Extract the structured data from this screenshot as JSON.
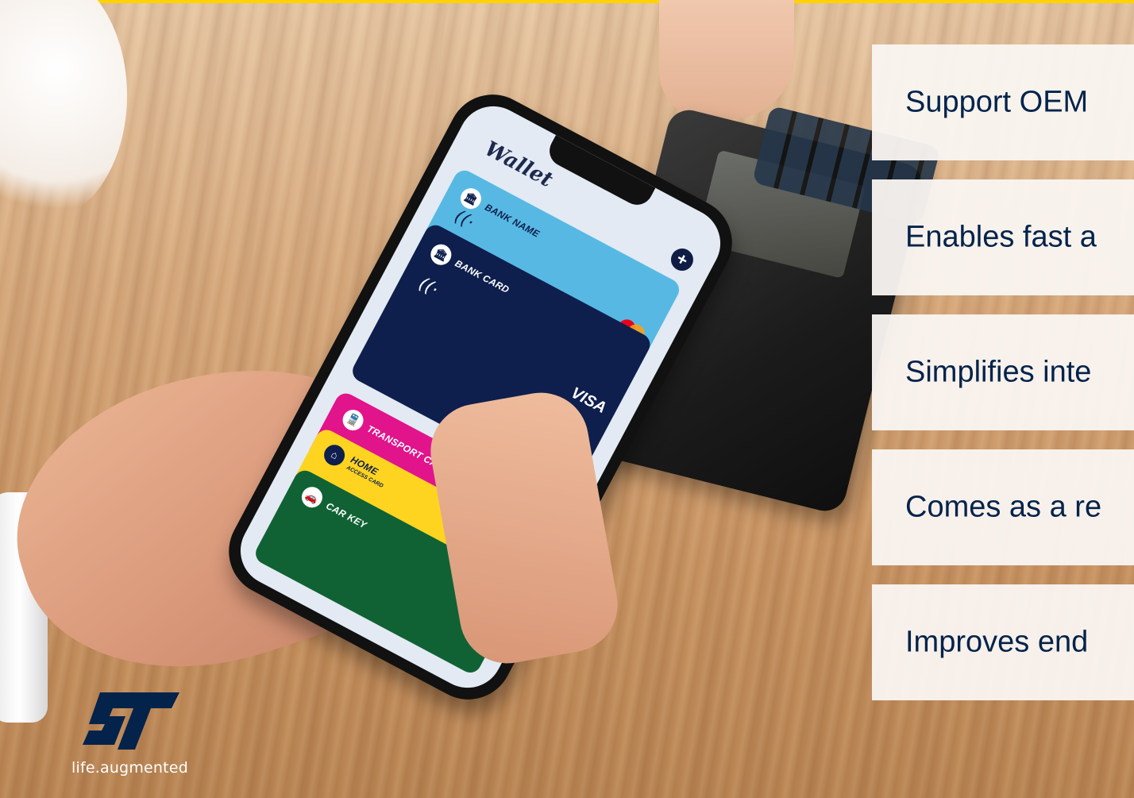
{
  "wallet": {
    "title": "Wallet",
    "add_button": "+",
    "cards": {
      "bank_name": "BANK NAME",
      "bank_card": "BANK CARD",
      "visa": "VISA",
      "transport": "TRANSPORT CARD",
      "home": "HOME",
      "home_sub": "ACCESS CARD",
      "car": "CAR KEY"
    }
  },
  "features": [
    "Support OEM",
    "Enables fast a",
    "Simplifies inte",
    "Comes as a re",
    "Improves end"
  ],
  "logo": {
    "tagline": "life.augmented"
  },
  "colors": {
    "accent_bar": "#ffd200",
    "feature_text": "#03234b",
    "logo_blue": "#03234b"
  }
}
